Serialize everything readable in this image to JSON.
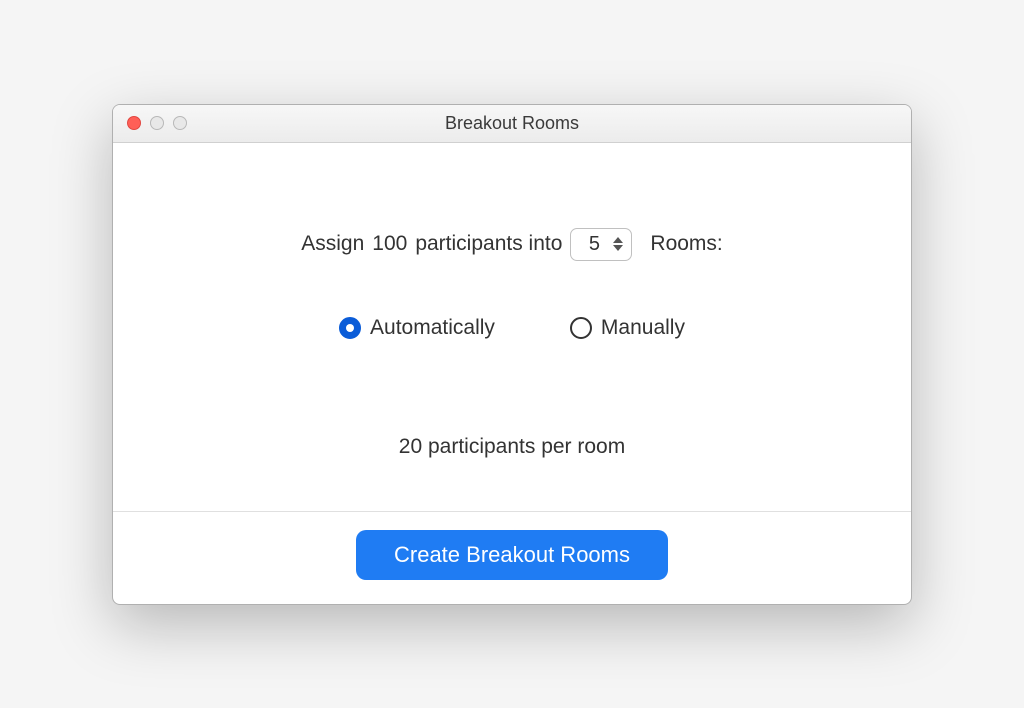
{
  "window": {
    "title": "Breakout Rooms"
  },
  "assign": {
    "prefix": "Assign",
    "participant_count": "100",
    "middle": "participants into",
    "room_count": "5",
    "suffix": "Rooms:"
  },
  "radio": {
    "automatically": "Automatically",
    "manually": "Manually"
  },
  "per_room": {
    "count": "20",
    "label": "participants per room"
  },
  "create_button": "Create Breakout Rooms"
}
